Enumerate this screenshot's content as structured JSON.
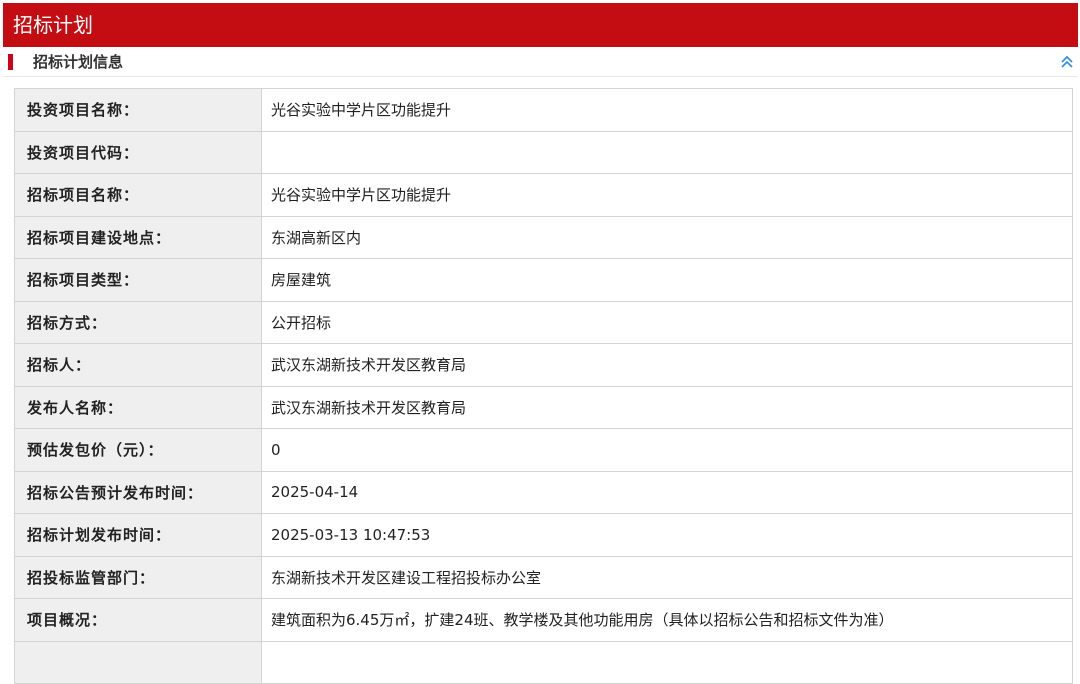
{
  "header": {
    "title": "招标计划"
  },
  "section": {
    "title": "招标计划信息",
    "collapse_icon": "chevron-double-up-icon"
  },
  "colors": {
    "header_bg": "#c40d12",
    "marker": "#d0021b",
    "icon": "#3a8ee6"
  },
  "rows": [
    {
      "label": "投资项目名称：",
      "value": "光谷实验中学片区功能提升"
    },
    {
      "label": "投资项目代码：",
      "value": ""
    },
    {
      "label": "招标项目名称：",
      "value": "光谷实验中学片区功能提升"
    },
    {
      "label": "招标项目建设地点：",
      "value": "东湖高新区内"
    },
    {
      "label": "招标项目类型：",
      "value": "房屋建筑"
    },
    {
      "label": "招标方式：",
      "value": "公开招标"
    },
    {
      "label": "招标人：",
      "value": "武汉东湖新技术开发区教育局"
    },
    {
      "label": "发布人名称：",
      "value": "武汉东湖新技术开发区教育局"
    },
    {
      "label": "预估发包价（元）：",
      "value": "0"
    },
    {
      "label": "招标公告预计发布时间：",
      "value": "2025-04-14"
    },
    {
      "label": "招标计划发布时间：",
      "value": "2025-03-13 10:47:53"
    },
    {
      "label": "招投标监管部门：",
      "value": "东湖新技术开发区建设工程招投标办公室"
    },
    {
      "label": "项目概况：",
      "value": "建筑面积为6.45万㎡，扩建24班、教学楼及其他功能用房（具体以招标公告和招标文件为准）"
    },
    {
      "label": "",
      "value": ""
    }
  ]
}
